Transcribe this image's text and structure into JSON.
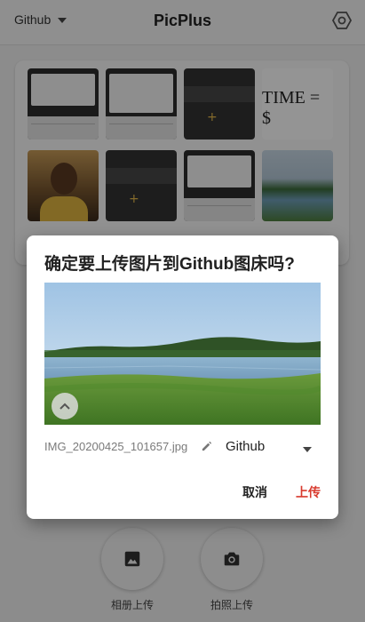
{
  "appbar": {
    "bed_selector_value": "Github",
    "title": "PicPlus",
    "settings_icon": "hexagon-gear-icon"
  },
  "gallery": {
    "thumbnails": [
      {
        "kind": "screenshot-ui"
      },
      {
        "kind": "screenshot-ui"
      },
      {
        "kind": "screenshot-dark"
      },
      {
        "kind": "text-image",
        "text": "TIME = $"
      },
      {
        "kind": "portrait"
      },
      {
        "kind": "screenshot-dark"
      },
      {
        "kind": "screenshot-ui"
      },
      {
        "kind": "lake-photo"
      }
    ]
  },
  "dialog": {
    "title": "确定要上传图片到Github图床吗?",
    "preview_alt": "lake landscape photo",
    "filename": "IMG_20200425_101657.jpg",
    "bed_select_value": "Github",
    "cancel_label": "取消",
    "upload_label": "上传"
  },
  "bottom_actions": {
    "album_label": "相册上传",
    "camera_label": "拍照上传",
    "album_icon": "image-icon",
    "camera_icon": "camera-icon"
  },
  "colors": {
    "accent": "#d83a2e",
    "scrim": "rgba(0,0,0,0.42)"
  }
}
